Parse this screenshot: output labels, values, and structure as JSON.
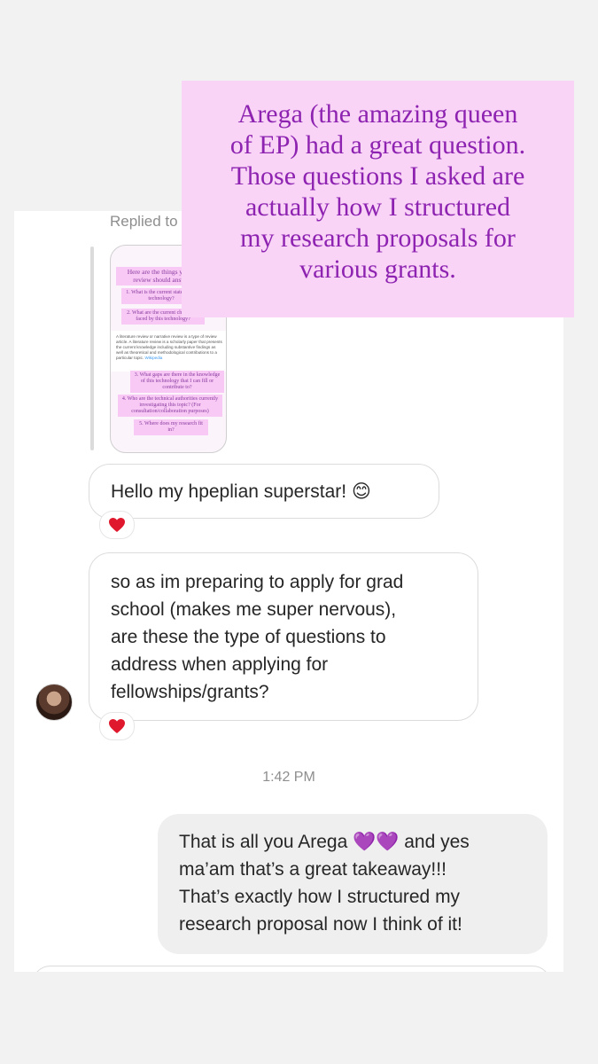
{
  "overlay": {
    "lines": [
      "Arega (the amazing queen",
      "of EP) had a great question.",
      "Those questions I asked are",
      "actually how I structured",
      "my research proposals for",
      "various grants."
    ]
  },
  "chat": {
    "replied_to": "Replied to your story",
    "story_preview": {
      "heading": "Here are the things your lit review should answer:",
      "q1": "1. What is the current state of the technology?",
      "q2": "2. What are the current challenges faced by this technology?",
      "paragraph": "A literature review or narrative review is a type of review article. A literature review is a scholarly paper that presents the current knowledge including substantive findings as well as theoretical and methodological contributions to a particular topic.",
      "paragraph_link": "Wikipedia",
      "q3": "3. What gaps are there in the knowledge of this technology that I can fill or contribute to?",
      "q4": "4. Who are the technical authorities currently investigating this topic? (For consultation/collaboration purposes)",
      "q5": "5. Where does my research fit in?"
    },
    "messages": [
      {
        "text": "Hello my hpeplian superstar! 😊",
        "reaction": "❤️"
      },
      {
        "lines": [
          "so as im preparing to apply for grad",
          "school (makes me super nervous),",
          "are these the type of questions to",
          "address when applying for",
          "fellowships/grants?"
        ],
        "reaction": "❤️"
      }
    ],
    "timestamp": "1:42 PM",
    "reply": {
      "lines": [
        "That is all you Arega 💜💜 and yes",
        "ma’am that’s a great takeaway!!!",
        "That’s exactly how I structured my",
        "research proposal now I think of it!"
      ]
    }
  }
}
